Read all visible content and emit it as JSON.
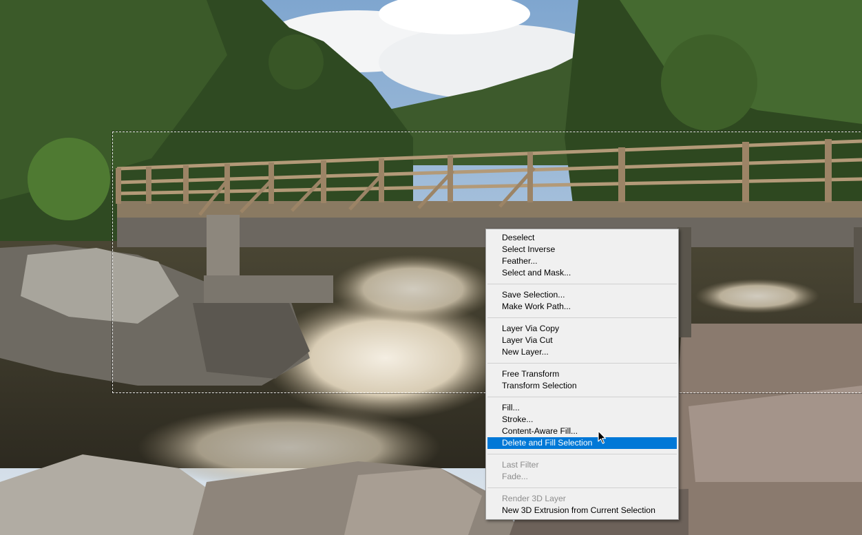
{
  "context_menu": {
    "groups": [
      [
        {
          "label": "Deselect",
          "enabled": true
        },
        {
          "label": "Select Inverse",
          "enabled": true
        },
        {
          "label": "Feather...",
          "enabled": true
        },
        {
          "label": "Select and Mask...",
          "enabled": true
        }
      ],
      [
        {
          "label": "Save Selection...",
          "enabled": true
        },
        {
          "label": "Make Work Path...",
          "enabled": true
        }
      ],
      [
        {
          "label": "Layer Via Copy",
          "enabled": true
        },
        {
          "label": "Layer Via Cut",
          "enabled": true
        },
        {
          "label": "New Layer...",
          "enabled": true
        }
      ],
      [
        {
          "label": "Free Transform",
          "enabled": true
        },
        {
          "label": "Transform Selection",
          "enabled": true
        }
      ],
      [
        {
          "label": "Fill...",
          "enabled": true
        },
        {
          "label": "Stroke...",
          "enabled": true
        },
        {
          "label": "Content-Aware Fill...",
          "enabled": true
        },
        {
          "label": "Delete and Fill Selection",
          "enabled": true,
          "highlighted": true
        }
      ],
      [
        {
          "label": "Last Filter",
          "enabled": false
        },
        {
          "label": "Fade...",
          "enabled": false
        }
      ],
      [
        {
          "label": "Render 3D Layer",
          "enabled": false
        },
        {
          "label": "New 3D Extrusion from Current Selection",
          "enabled": true
        }
      ]
    ]
  },
  "colors": {
    "highlight": "#0078d7",
    "menu_bg": "#f0f0f0",
    "disabled_text": "#8d8d8d"
  },
  "icons": {
    "cursor": "arrow-pointer-icon"
  }
}
